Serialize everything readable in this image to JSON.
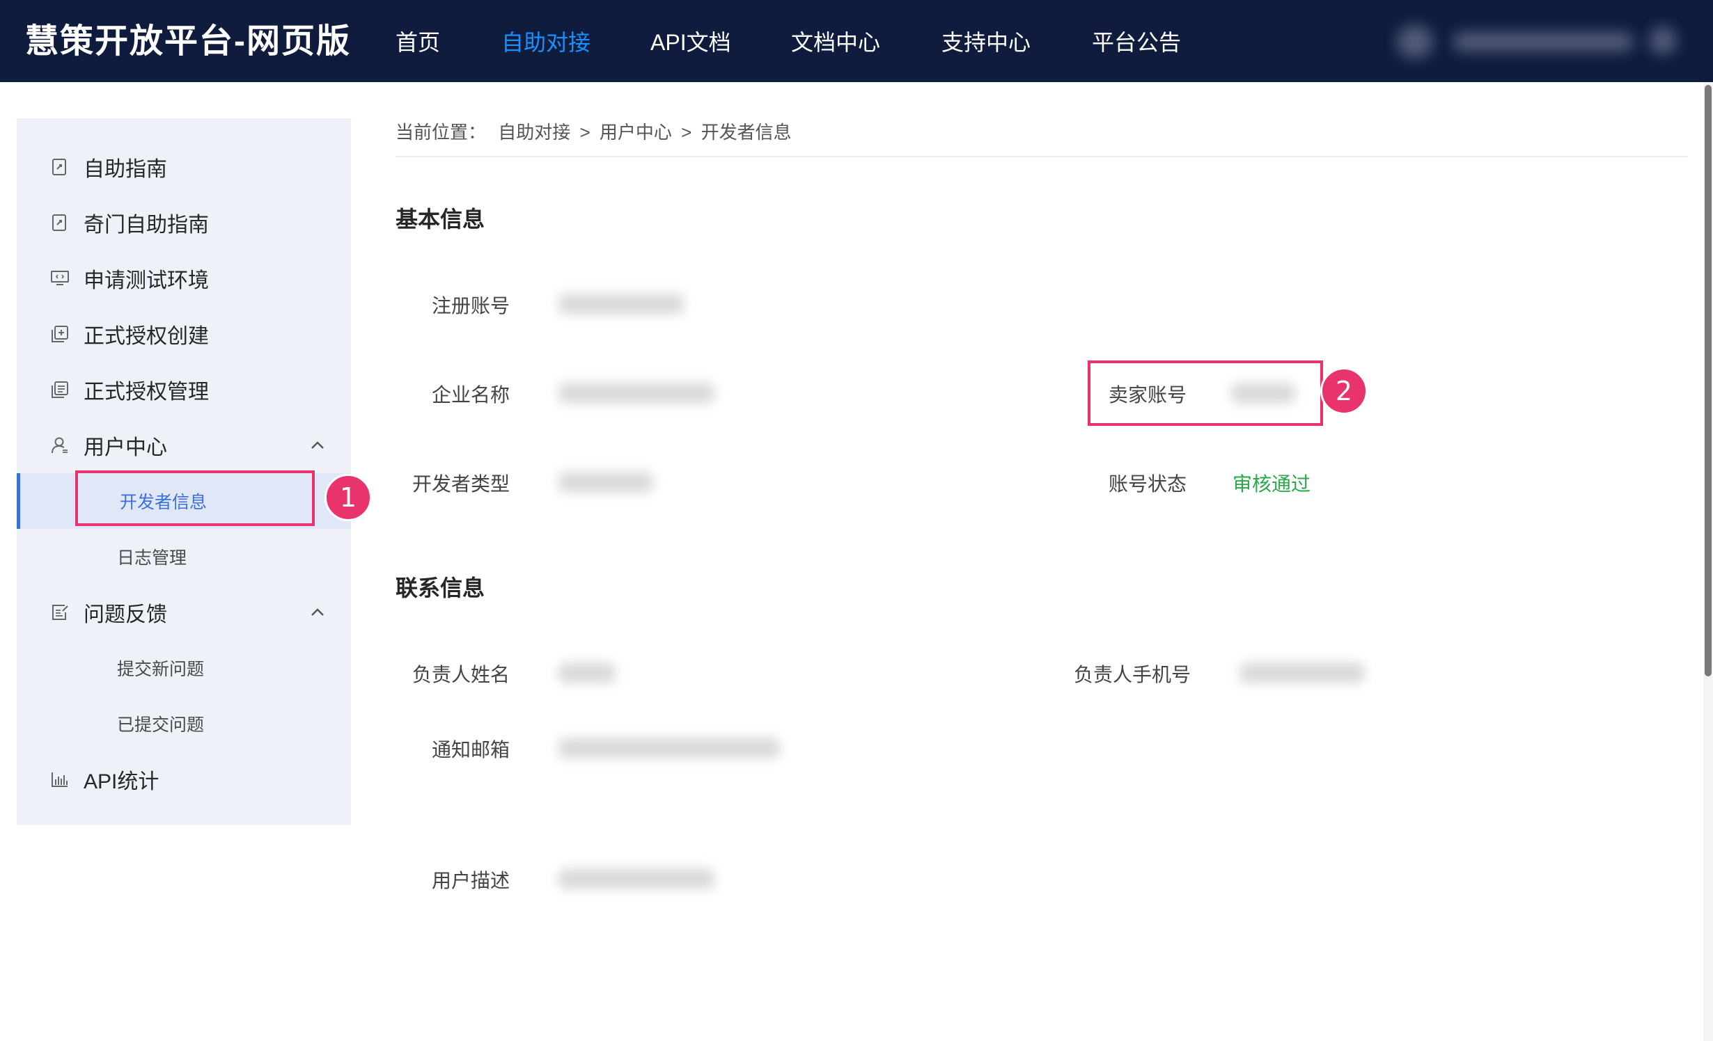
{
  "header": {
    "brand": "慧策开放平台-网页版",
    "nav": [
      {
        "label": "首页",
        "active": false
      },
      {
        "label": "自助对接",
        "active": true
      },
      {
        "label": "API文档",
        "active": false
      },
      {
        "label": "文档中心",
        "active": false
      },
      {
        "label": "支持中心",
        "active": false
      },
      {
        "label": "平台公告",
        "active": false
      }
    ],
    "active_color": "#1890ff",
    "background": "#101c3d"
  },
  "sidebar": {
    "items": [
      {
        "label": "自助指南",
        "icon": "document-icon"
      },
      {
        "label": "奇门自助指南",
        "icon": "document-icon"
      },
      {
        "label": "申请测试环境",
        "icon": "monitor-code-icon"
      },
      {
        "label": "正式授权创建",
        "icon": "add-square-icon"
      },
      {
        "label": "正式授权管理",
        "icon": "list-square-icon"
      },
      {
        "label": "用户中心",
        "icon": "user-icon",
        "expanded": true,
        "children": [
          {
            "label": "开发者信息",
            "active": true
          },
          {
            "label": "日志管理",
            "active": false
          }
        ]
      },
      {
        "label": "问题反馈",
        "icon": "feedback-icon",
        "expanded": true,
        "children": [
          {
            "label": "提交新问题",
            "active": false
          },
          {
            "label": "已提交问题",
            "active": false
          }
        ]
      },
      {
        "label": "API统计",
        "icon": "bar-chart-icon"
      }
    ],
    "active_color": "#3b6fe0"
  },
  "annotations": {
    "badge1": "1",
    "badge2": "2",
    "color": "#e8336d"
  },
  "breadcrumb": {
    "prefix": "当前位置：",
    "items": [
      "自助对接",
      "用户中心",
      "开发者信息"
    ],
    "separator": ">"
  },
  "basic_info": {
    "title": "基本信息",
    "fields": {
      "register_account": {
        "label": "注册账号"
      },
      "company_name": {
        "label": "企业名称"
      },
      "seller_account": {
        "label": "卖家账号"
      },
      "developer_type": {
        "label": "开发者类型"
      },
      "account_status": {
        "label": "账号状态",
        "value": "审核通过",
        "value_color": "#2aa84a"
      }
    }
  },
  "contact_info": {
    "title": "联系信息",
    "fields": {
      "contact_name": {
        "label": "负责人姓名"
      },
      "contact_phone": {
        "label": "负责人手机号"
      },
      "notify_email": {
        "label": "通知邮箱"
      },
      "user_desc": {
        "label": "用户描述"
      }
    }
  }
}
